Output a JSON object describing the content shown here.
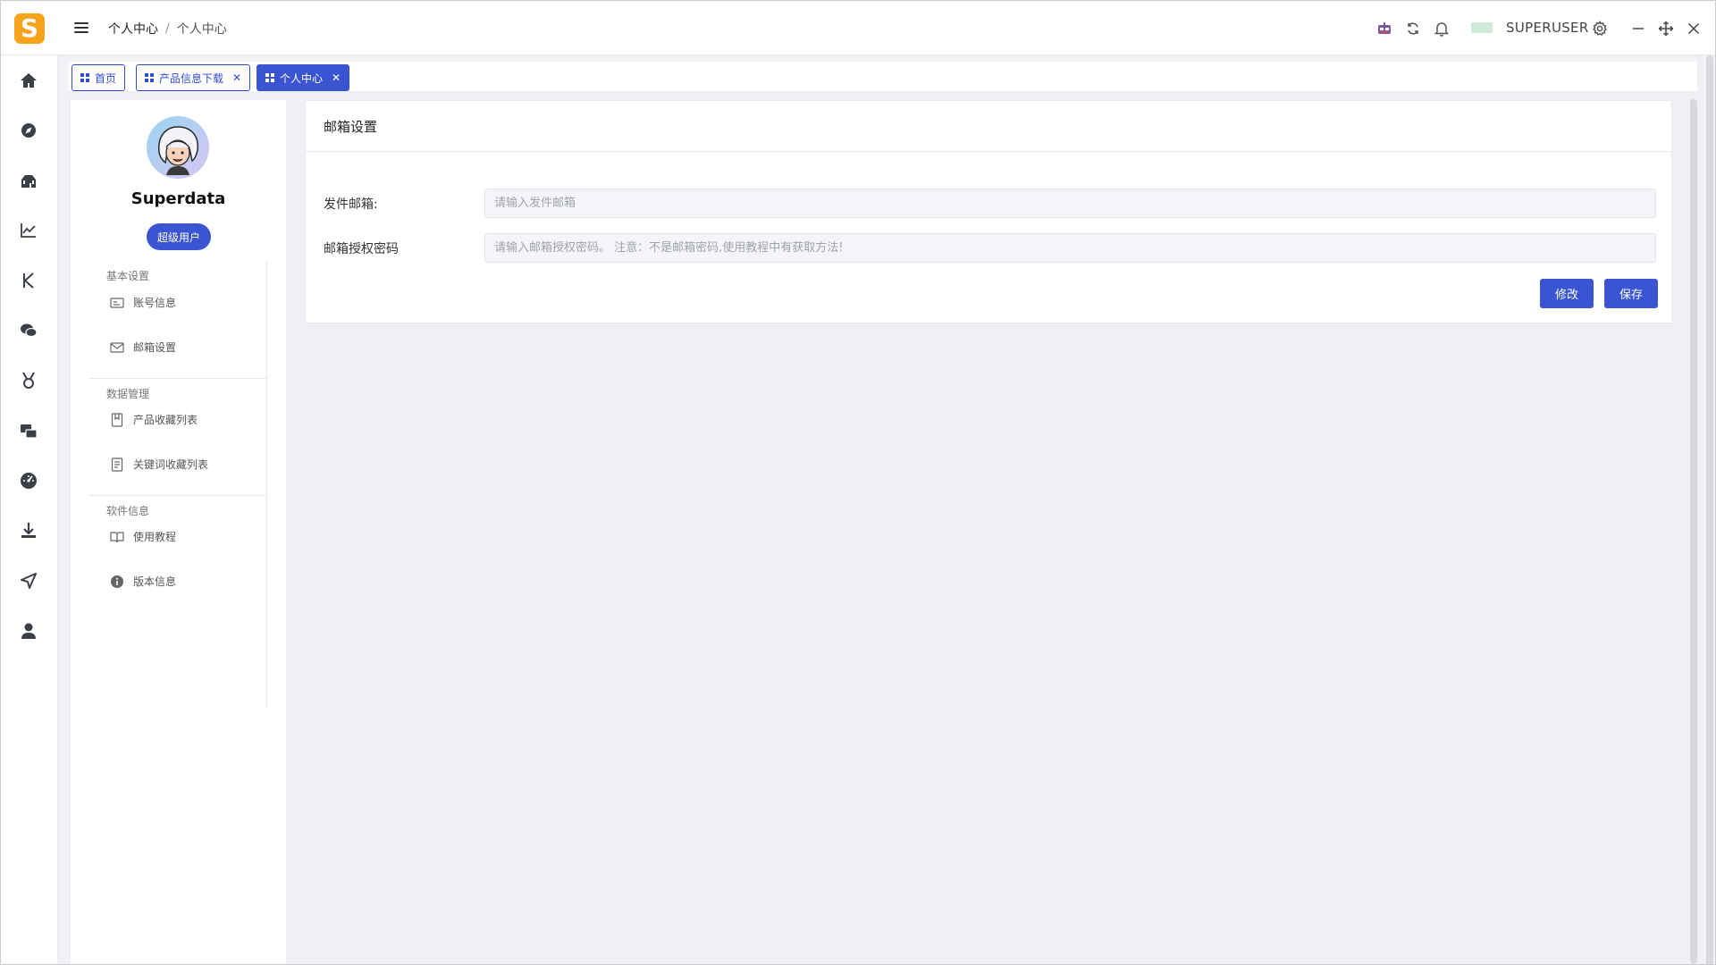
{
  "app": {
    "logo_letter": "S",
    "brand_color": "#f7a21b",
    "accent": "#3b54d1"
  },
  "breadcrumb": {
    "parent": "个人中心",
    "separator": "/",
    "current": "个人中心"
  },
  "topbar": {
    "username": "SUPERUSER"
  },
  "tabs": [
    {
      "label": "首页",
      "closable": false,
      "active": false
    },
    {
      "label": "产品信息下载",
      "closable": true,
      "active": false
    },
    {
      "label": "个人中心",
      "closable": true,
      "active": true
    }
  ],
  "leftnav": [
    "home-icon",
    "compass-icon",
    "store-icon",
    "line-chart-icon",
    "k-icon",
    "chat-icon",
    "medal-icon",
    "transfer-icon",
    "dashboard-icon",
    "download-icon",
    "send-icon",
    "user-icon"
  ],
  "profile": {
    "name": "Superdata",
    "role_badge": "超级用户",
    "menu": {
      "basic_section": "基本设置",
      "account_info": "账号信息",
      "email_settings": "邮箱设置",
      "data_section": "数据管理",
      "product_favorites": "产品收藏列表",
      "keyword_favorites": "关键词收藏列表",
      "software_section": "软件信息",
      "tutorial": "使用教程",
      "version_info": "版本信息"
    }
  },
  "email_card": {
    "title": "邮箱设置",
    "sender_label": "发件邮箱:",
    "sender_value": "",
    "sender_placeholder": "请输入发件邮箱",
    "auth_label": "邮箱授权密码",
    "auth_value": "",
    "auth_placeholder": "请输入邮箱授权密码。 注意：不是邮箱密码,使用教程中有获取方法!",
    "edit_button": "修改",
    "save_button": "保存"
  }
}
